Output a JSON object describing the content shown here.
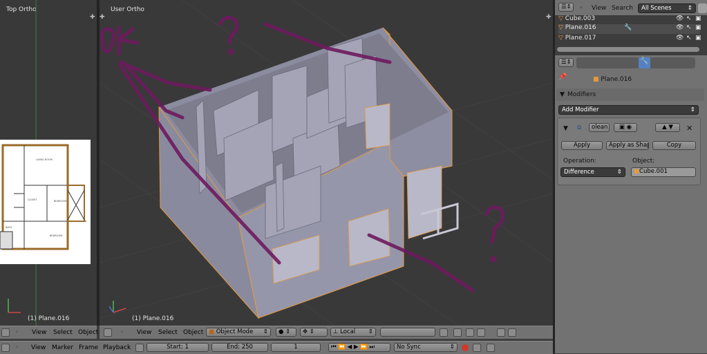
{
  "left_viewport": {
    "title": "Top Ortho",
    "object_label": "(1) Plane.016"
  },
  "main_viewport": {
    "title": "User Ortho",
    "object_label": "(1) Plane.016"
  },
  "left_header": {
    "view": "View",
    "select": "Select",
    "object": "Object"
  },
  "main_header": {
    "view": "View",
    "select": "Select",
    "object": "Object",
    "mode": "Object Mode",
    "orientation": "Local"
  },
  "timeline": {
    "view": "View",
    "marker": "Marker",
    "frame": "Frame",
    "playback": "Playback",
    "start": "Start: 1",
    "end": "End: 250",
    "current": "1",
    "sync": "No Sync"
  },
  "outliner": {
    "view": "View",
    "search": "Search",
    "scene_filter": "All Scenes",
    "items": [
      "Cube.003",
      "Plane.016",
      "Plane.017"
    ]
  },
  "properties": {
    "object_name": "Plane.016",
    "modifiers_header": "Modifiers",
    "add_modifier": "Add Modifier",
    "modifier_name": "olean",
    "apply": "Apply",
    "apply_shape": "Apply as Shape",
    "copy": "Copy",
    "operation_label": "Operation:",
    "operation_value": "Difference",
    "object_label": "Object:",
    "object_value": "Cube.001"
  },
  "annotations": {
    "ok_text": "OK",
    "q1": "?",
    "q2": "?"
  },
  "floorplan": {
    "labels": [
      "LIVING ROOM",
      "BEDROOM",
      "BEDROOM",
      "CLOSET",
      "BATH"
    ]
  },
  "colors": {
    "annotation": "#6e1a5e",
    "selection": "#e59a3c",
    "wall": "#8e8ea0"
  }
}
